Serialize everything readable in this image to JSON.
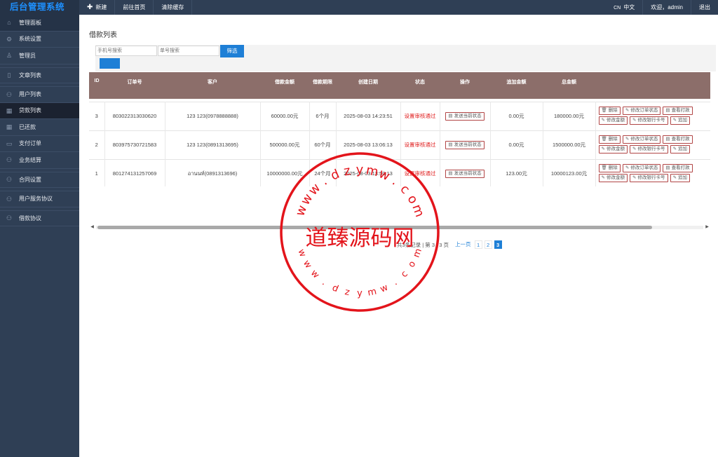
{
  "brand": "后台管理系统",
  "sidebar": {
    "items": [
      {
        "label": "管理面板",
        "icon": "home-icon",
        "active": true
      },
      {
        "label": "系统设置",
        "icon": "gear-icon"
      },
      {
        "label": "管理员",
        "icon": "user-icon"
      },
      {
        "label": "文章列表",
        "icon": "file-icon"
      },
      {
        "label": "用户列表",
        "icon": "users-icon"
      },
      {
        "label": "贷款列表",
        "icon": "grid-icon",
        "active": true
      },
      {
        "label": "已还款",
        "icon": "grid-icon"
      },
      {
        "label": "支付订单",
        "icon": "card-icon"
      },
      {
        "label": "业务结算",
        "icon": "users-icon"
      },
      {
        "label": "合同设置",
        "icon": "users-icon"
      },
      {
        "label": "用户服务协议",
        "icon": "users-icon"
      },
      {
        "label": "借款协议",
        "icon": "users-icon"
      }
    ]
  },
  "topbar": {
    "new_label": "新建",
    "home_label": "前往首页",
    "clear_cache_label": "清除缓存",
    "lang_code": "CN",
    "lang_label": "中文",
    "welcome": "欢迎，admin",
    "logout": "退出"
  },
  "page": {
    "title": "借款列表"
  },
  "filter": {
    "phone_placeholder": "手机号搜索",
    "order_placeholder": "单号搜索",
    "filter_button": "筛选"
  },
  "table": {
    "headers": [
      "ID",
      "订单号",
      "客户",
      "借款金额",
      "借款期限",
      "创建日期",
      "状态",
      "操作",
      "追加金额",
      "总金额"
    ],
    "rows": [
      {
        "id": "3",
        "order_no": "803022313030620",
        "customer": "123 123(0978888888)",
        "amount": "60000.00元",
        "term": "6个月",
        "created": "2025-08-03 14:23:51",
        "status": "设置审核通过",
        "action": "发送当前状态",
        "extra": "0.00元",
        "total": "180000.00元"
      },
      {
        "id": "2",
        "order_no": "803975730721583",
        "customer": "123 123(0891313695)",
        "amount": "500000.00元",
        "term": "60个月",
        "created": "2025-08-03 13:06:13",
        "status": "设置审核通过",
        "action": "发送当前状态",
        "extra": "0.00元",
        "total": "1500000.00元"
      },
      {
        "id": "1",
        "order_no": "801274131257069",
        "customer": "อานนท์(0891313696)",
        "amount": "10000000.00元",
        "term": "24个月",
        "created": "2025-08-03 13:50:13",
        "status": "设置审核通过",
        "action": "发送当前状态",
        "extra": "123.00元",
        "total": "10000123.00元"
      }
    ],
    "row_buttons": {
      "delete": "删除",
      "edit_status": "修改订单状态",
      "view_print": "查看打款",
      "edit_amount": "修改金额",
      "edit_bank": "修改银行卡号",
      "append": "追加"
    }
  },
  "pager": {
    "summary": "共3条记录 | 第 3 / 3 页",
    "prev": "上一页",
    "pages": [
      "1",
      "2",
      "3"
    ],
    "current": "3"
  },
  "watermark": {
    "center_text": "道臻源码网",
    "ring_text": "www.dzymw.com"
  },
  "colors": {
    "sidebar_bg": "#2f3f55",
    "brand_text": "#1e90ff",
    "header_row_bg": "#8c6e6a",
    "primary_button": "#1e7fd6",
    "status_red": "#e02020",
    "stamp_red": "#e3141b"
  }
}
